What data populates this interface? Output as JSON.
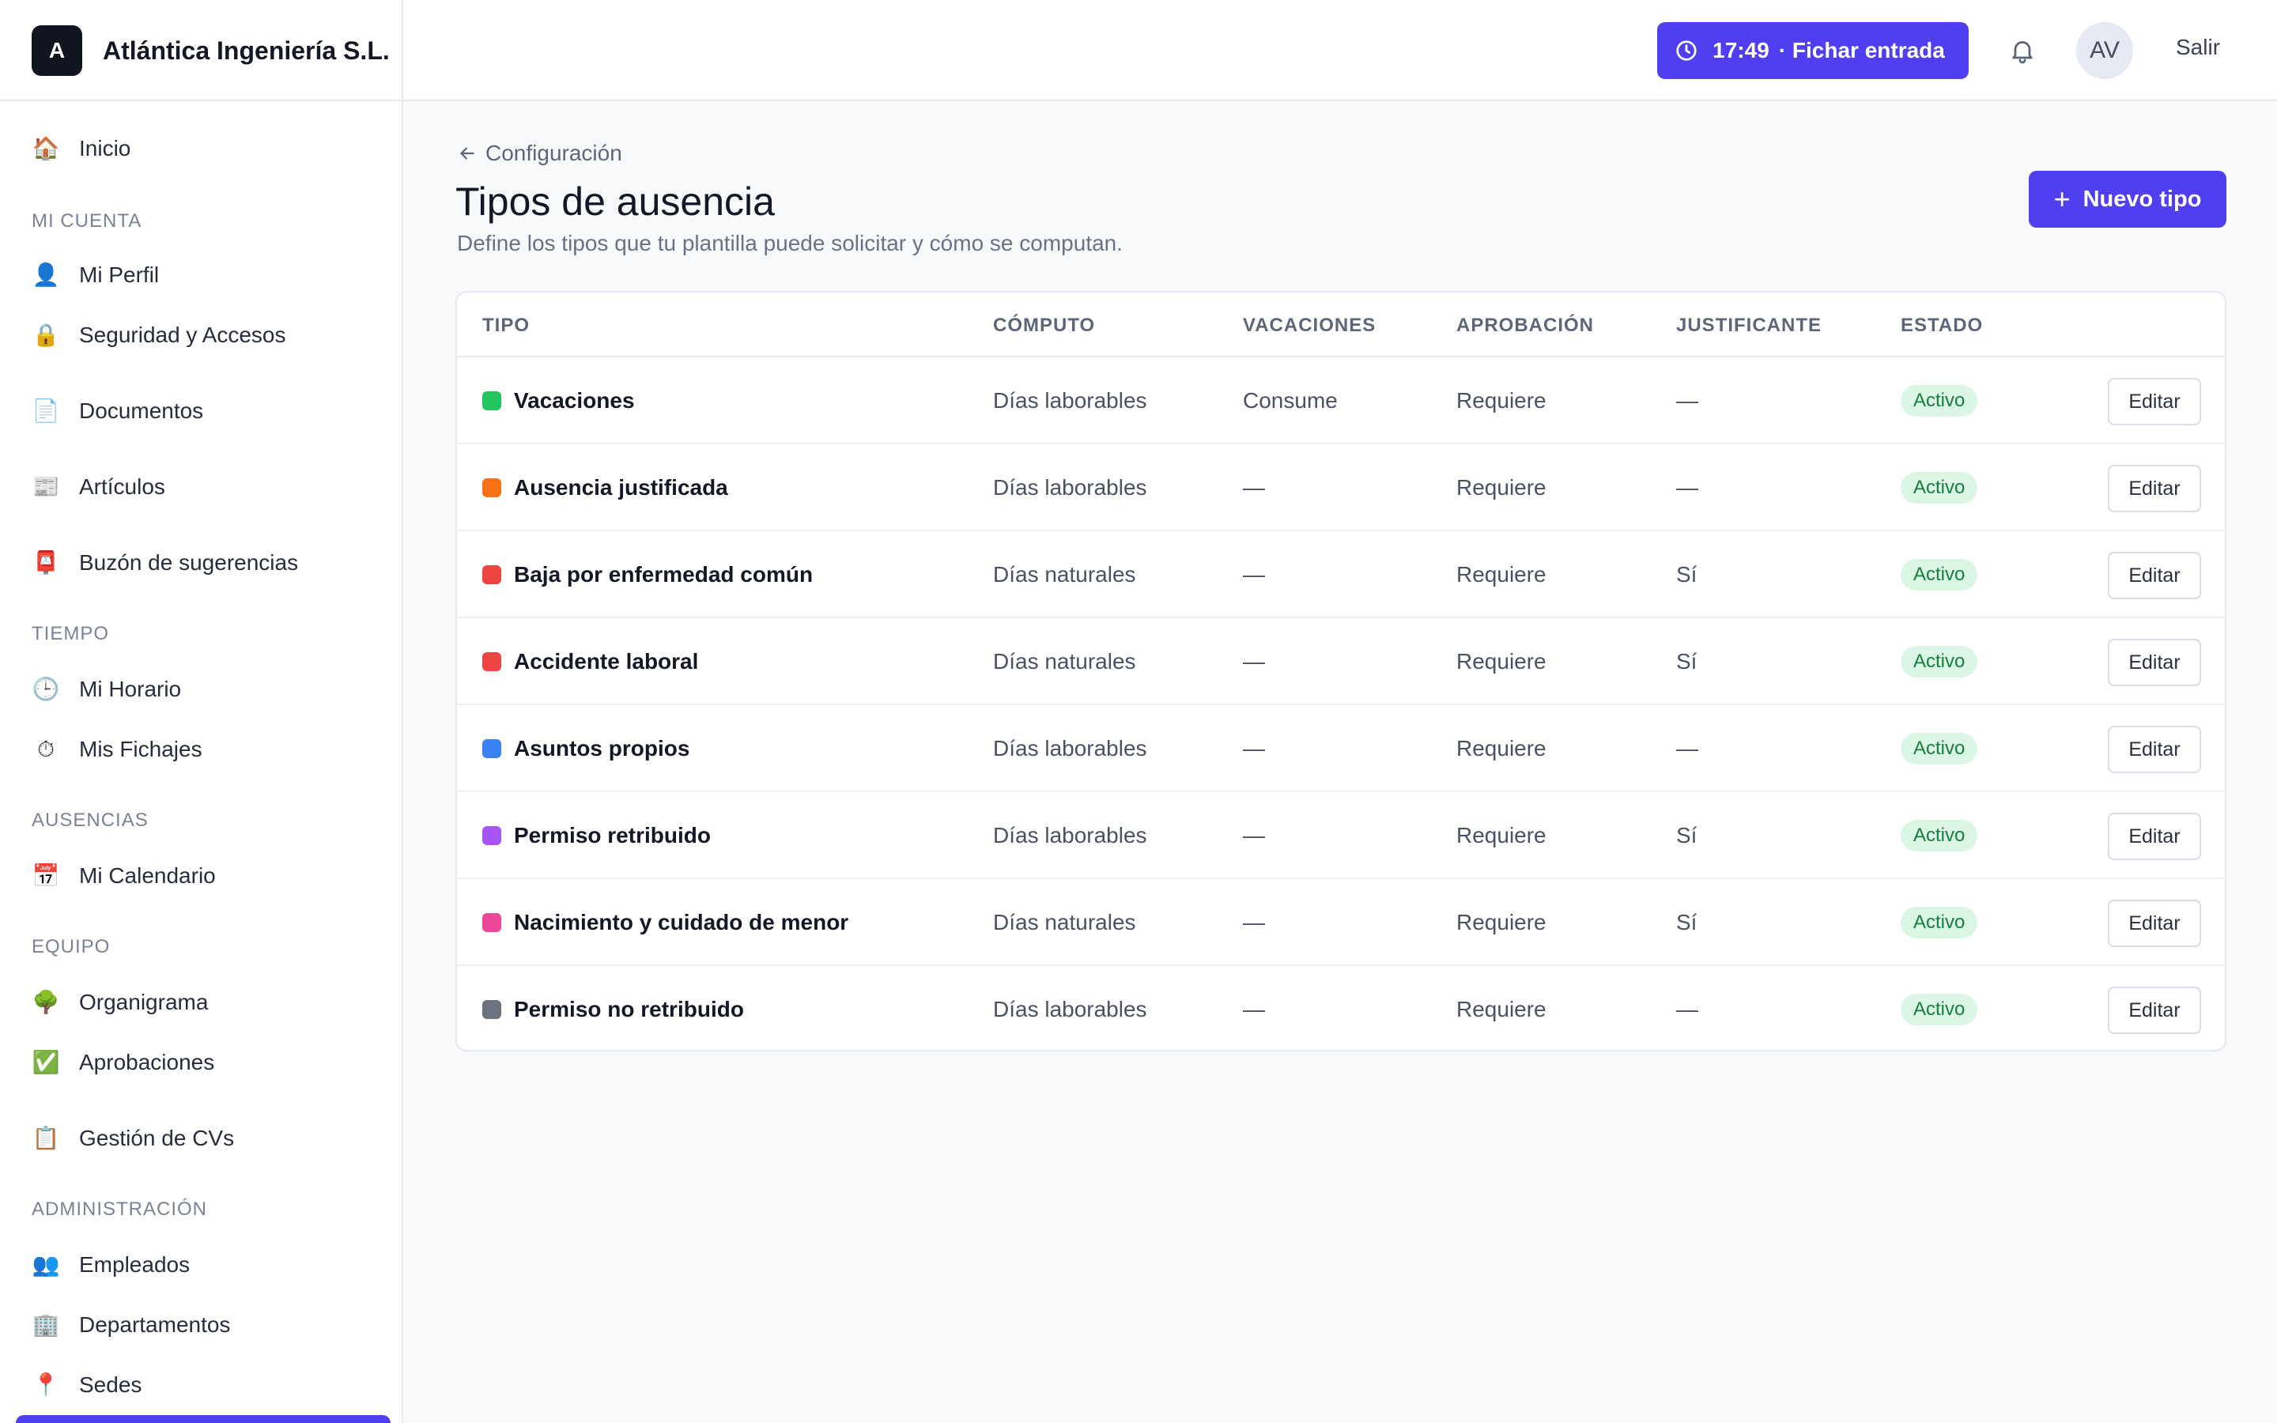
{
  "brand": {
    "logo_letter": "A",
    "name": "Atlántica Ingeniería S.L."
  },
  "header": {
    "clock_time": "17:49",
    "clock_action": "· Fichar entrada",
    "avatar_initials": "AV",
    "logout_label": "Salir"
  },
  "sidebar": {
    "inicio": "Inicio",
    "sections": {
      "mi_cuenta": "MI CUENTA",
      "tiempo": "TIEMPO",
      "ausencias": "AUSENCIAS",
      "equipo": "EQUIPO",
      "administracion": "ADMINISTRACIÓN"
    },
    "items": {
      "perfil": "Mi Perfil",
      "seguridad": "Seguridad y Accesos",
      "documentos": "Documentos",
      "articulos": "Artículos",
      "buzon": "Buzón de sugerencias",
      "horario": "Mi Horario",
      "fichajes": "Mis Fichajes",
      "calendario": "Mi Calendario",
      "organigrama": "Organigrama",
      "aprobaciones": "Aprobaciones",
      "cvs": "Gestión de CVs",
      "empleados": "Empleados",
      "departamentos": "Departamentos",
      "sedes": "Sedes"
    },
    "icons": {
      "inicio": "🏠",
      "perfil": "👤",
      "seguridad": "🔒",
      "documentos": "📄",
      "articulos": "📰",
      "buzon": "📮",
      "horario": "🕒",
      "fichajes": "⏱",
      "calendario": "📅",
      "organigrama": "🌳",
      "aprobaciones": "✅",
      "cvs": "📋",
      "empleados": "👥",
      "departamentos": "🏢",
      "sedes": "📍"
    }
  },
  "main": {
    "breadcrumb": "Configuración",
    "title": "Tipos de ausencia",
    "subtitle": "Define los tipos que tu plantilla puede solicitar y cómo se computan.",
    "new_button": "Nuevo tipo",
    "columns": {
      "tipo": "TIPO",
      "computo": "CÓMPUTO",
      "vacaciones": "VACACIONES",
      "aprobacion": "APROBACIÓN",
      "justificante": "JUSTIFICANTE",
      "estado": "ESTADO"
    },
    "rows": [
      {
        "name": "Vacaciones",
        "color": "#22c55e",
        "computo": "Días laborables",
        "vacaciones": "Consume",
        "aprobacion": "Requiere",
        "justificante": "—",
        "estado": "Activo",
        "action": "Editar"
      },
      {
        "name": "Ausencia justificada",
        "color": "#f97316",
        "computo": "Días laborables",
        "vacaciones": "—",
        "aprobacion": "Requiere",
        "justificante": "—",
        "estado": "Activo",
        "action": "Editar"
      },
      {
        "name": "Baja por enfermedad común",
        "color": "#ef4444",
        "computo": "Días naturales",
        "vacaciones": "—",
        "aprobacion": "Requiere",
        "justificante": "Sí",
        "estado": "Activo",
        "action": "Editar"
      },
      {
        "name": "Accidente laboral",
        "color": "#ef4444",
        "computo": "Días naturales",
        "vacaciones": "—",
        "aprobacion": "Requiere",
        "justificante": "Sí",
        "estado": "Activo",
        "action": "Editar"
      },
      {
        "name": "Asuntos propios",
        "color": "#3b82f6",
        "computo": "Días laborables",
        "vacaciones": "—",
        "aprobacion": "Requiere",
        "justificante": "—",
        "estado": "Activo",
        "action": "Editar"
      },
      {
        "name": "Permiso retribuido",
        "color": "#a855f7",
        "computo": "Días laborables",
        "vacaciones": "—",
        "aprobacion": "Requiere",
        "justificante": "Sí",
        "estado": "Activo",
        "action": "Editar"
      },
      {
        "name": "Nacimiento y cuidado de menor",
        "color": "#ec4899",
        "computo": "Días naturales",
        "vacaciones": "—",
        "aprobacion": "Requiere",
        "justificante": "Sí",
        "estado": "Activo",
        "action": "Editar"
      },
      {
        "name": "Permiso no retribuido",
        "color": "#6b7280",
        "computo": "Días laborables",
        "vacaciones": "—",
        "aprobacion": "Requiere",
        "justificante": "—",
        "estado": "Activo",
        "action": "Editar"
      }
    ]
  },
  "colors": {
    "accent": "#4f3ff0",
    "active_badge_bg": "#dcf6e6",
    "active_badge_text": "#15803d"
  }
}
